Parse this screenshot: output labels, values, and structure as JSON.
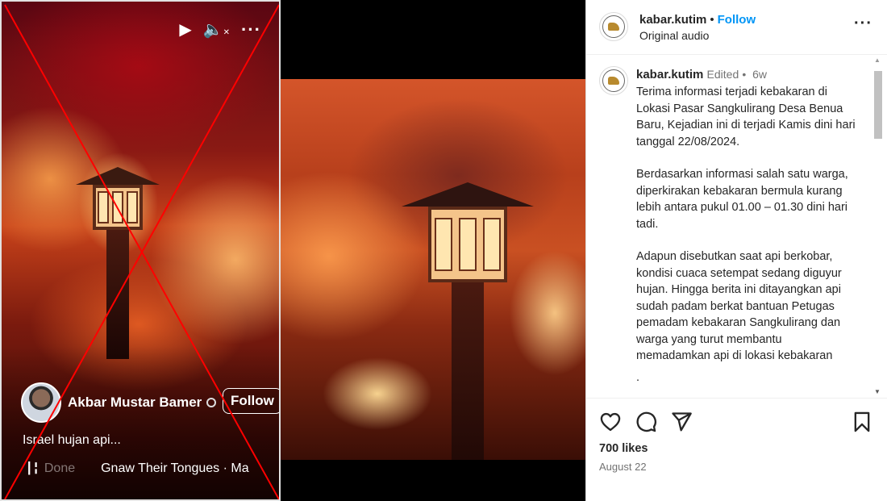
{
  "facebook_reel": {
    "username": "Akbar Mustar Bamer",
    "follow_label": "Follow",
    "caption": "Israel hujan api...",
    "audio_done": "Done",
    "audio_track": "Gnaw Their Tongues · Ma"
  },
  "instagram": {
    "header": {
      "username": "kabar.kutim",
      "separator": "•",
      "follow_label": "Follow",
      "audio": "Original audio"
    },
    "caption": {
      "username": "kabar.kutim",
      "edited": "Edited",
      "separator": "•",
      "time_ago": "6w",
      "paragraphs": [
        "Terima informasi terjadi kebakaran di Lokasi Pasar Sangkulirang Desa Benua Baru, Kejadian ini di terjadi Kamis dini hari tanggal 22/08/2024.",
        "Berdasarkan informasi salah satu warga, diperkirakan kebakaran bermula kurang lebih antara pukul 01.00 – 01.30 dini hari tadi.",
        "Adapun disebutkan saat api berkobar, kondisi cuaca setempat sedang diguyur hujan. Hingga berita ini ditayangkan api sudah padam berkat bantuan Petugas pemadam kebakaran Sangkulirang dan warga yang turut membantu memadamkan api di lokasi kebakaran"
      ],
      "trailing_dots": [
        ".",
        "."
      ]
    },
    "likes": "700 likes",
    "date": "August 22"
  },
  "colors": {
    "ig_link_blue": "#0095f6",
    "ig_text": "#262626",
    "ig_muted": "#737373",
    "cross_red": "#ff0000"
  },
  "icons": [
    "play-icon",
    "mute-icon",
    "more-icon",
    "globe-icon",
    "audio-wave-icon",
    "heart-icon",
    "comment-icon",
    "share-icon",
    "bookmark-icon"
  ]
}
